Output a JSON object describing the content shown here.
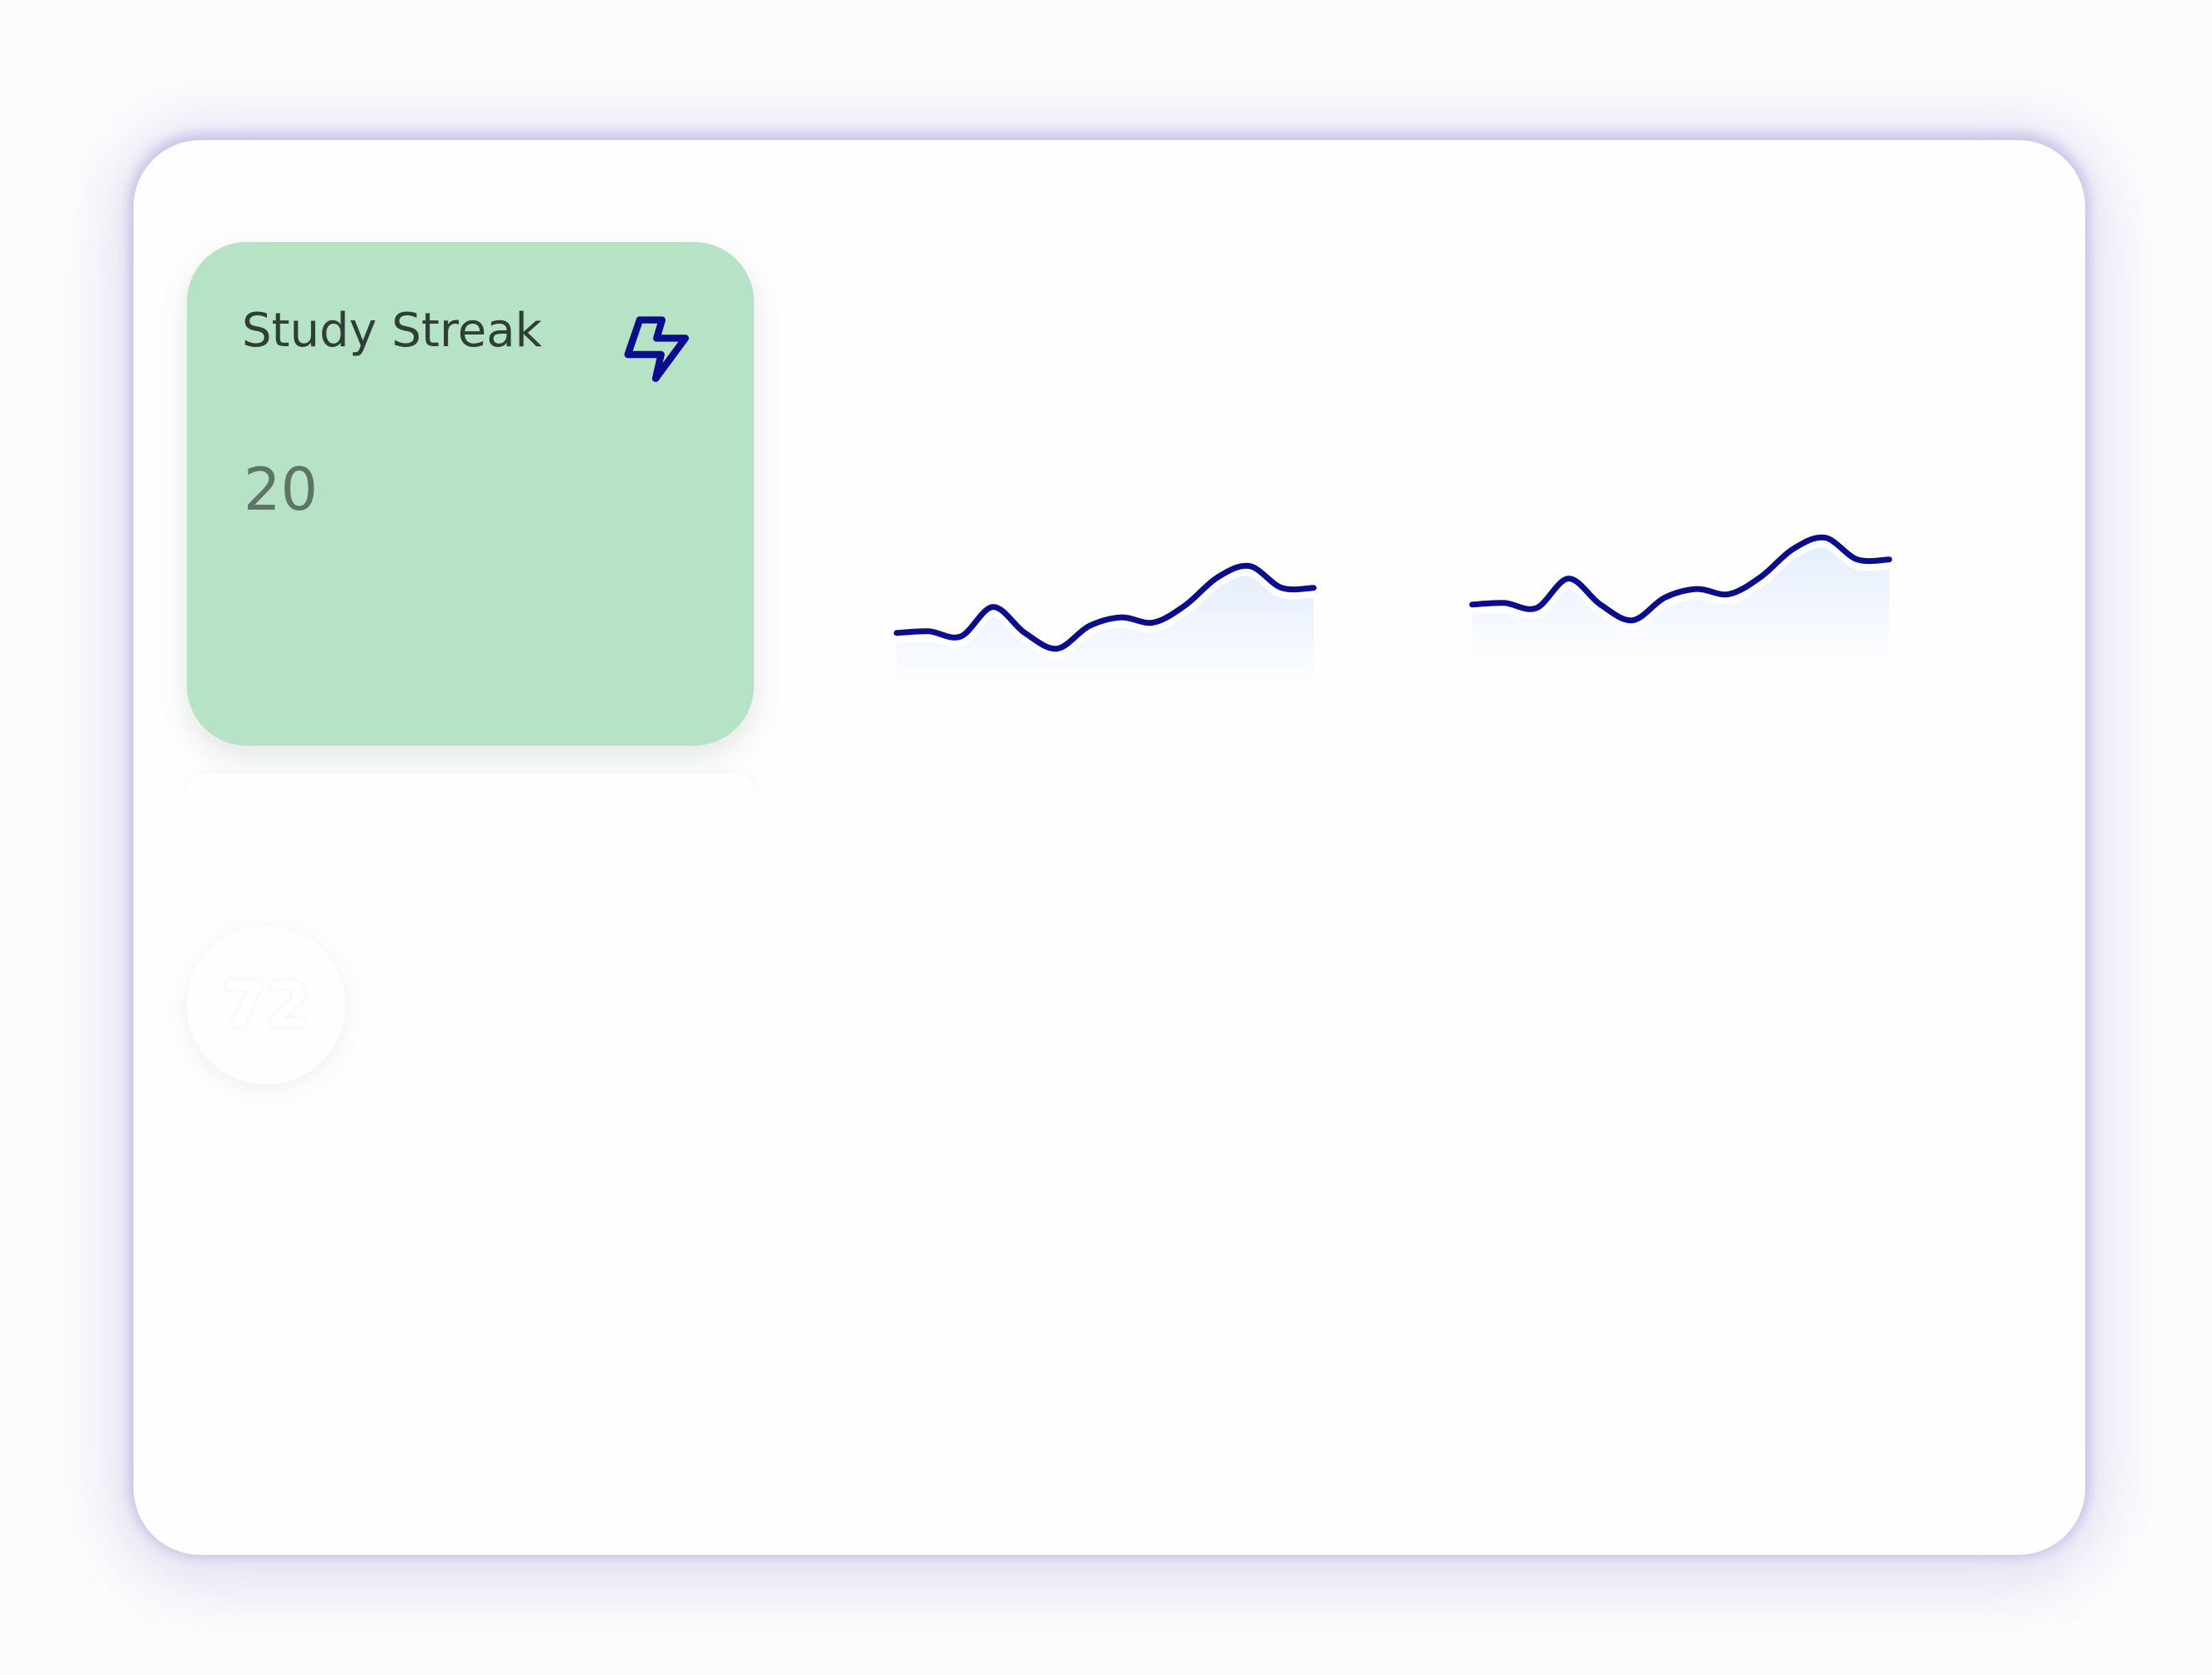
{
  "cards": [
    {
      "title": "Study Streak",
      "value": "20",
      "icon": "lightning-icon",
      "background": "#b6e3c6"
    }
  ],
  "badge": {
    "value": "72"
  },
  "sparklines": [
    {
      "icon": "trend-sparkline",
      "stroke": "#0b0d8c",
      "fill": "#e3edfd",
      "values": [
        28,
        30,
        24,
        58,
        28,
        10,
        36,
        46,
        40,
        60,
        92,
        105,
        80,
        80
      ]
    },
    {
      "icon": "trend-sparkline",
      "stroke": "#0b0d8c",
      "fill": "#e3edfd",
      "values": [
        28,
        30,
        24,
        58,
        28,
        10,
        36,
        46,
        40,
        60,
        92,
        105,
        80,
        80
      ]
    }
  ],
  "colors": {
    "panel": "#fefefe",
    "accent": "#0b0d8c",
    "card_text": "#2f3f38",
    "card_value": "#5d7466"
  }
}
